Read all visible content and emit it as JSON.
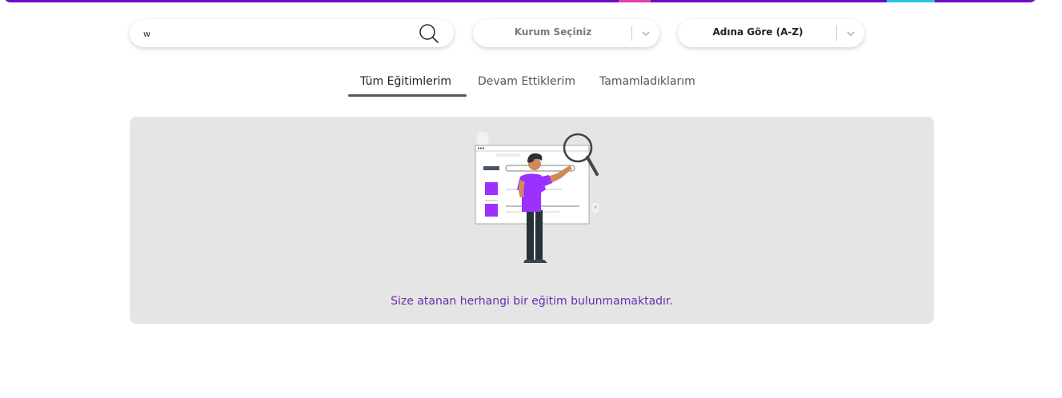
{
  "search": {
    "value": "w",
    "icon": "search-icon"
  },
  "filters": {
    "institution_label": "Kurum Seçiniz",
    "sort_label": "Adına Göre (A-Z)",
    "chevron_icon": "chevron-down-icon"
  },
  "tabs": [
    {
      "label": "Tüm Eğitimlerim",
      "active": true
    },
    {
      "label": "Devam Ettiklerim",
      "active": false
    },
    {
      "label": "Tamamladıklarım",
      "active": false
    }
  ],
  "empty_state": {
    "message": "Size atanan herhangi bir eğitim bulunmamaktadır.",
    "illustration": "person-searching-illustration"
  },
  "colors": {
    "brand": "#6a0dc4",
    "accent_purple": "#9b30ff",
    "message": "#6a2db0",
    "panel_bg": "#e5e5e5"
  }
}
